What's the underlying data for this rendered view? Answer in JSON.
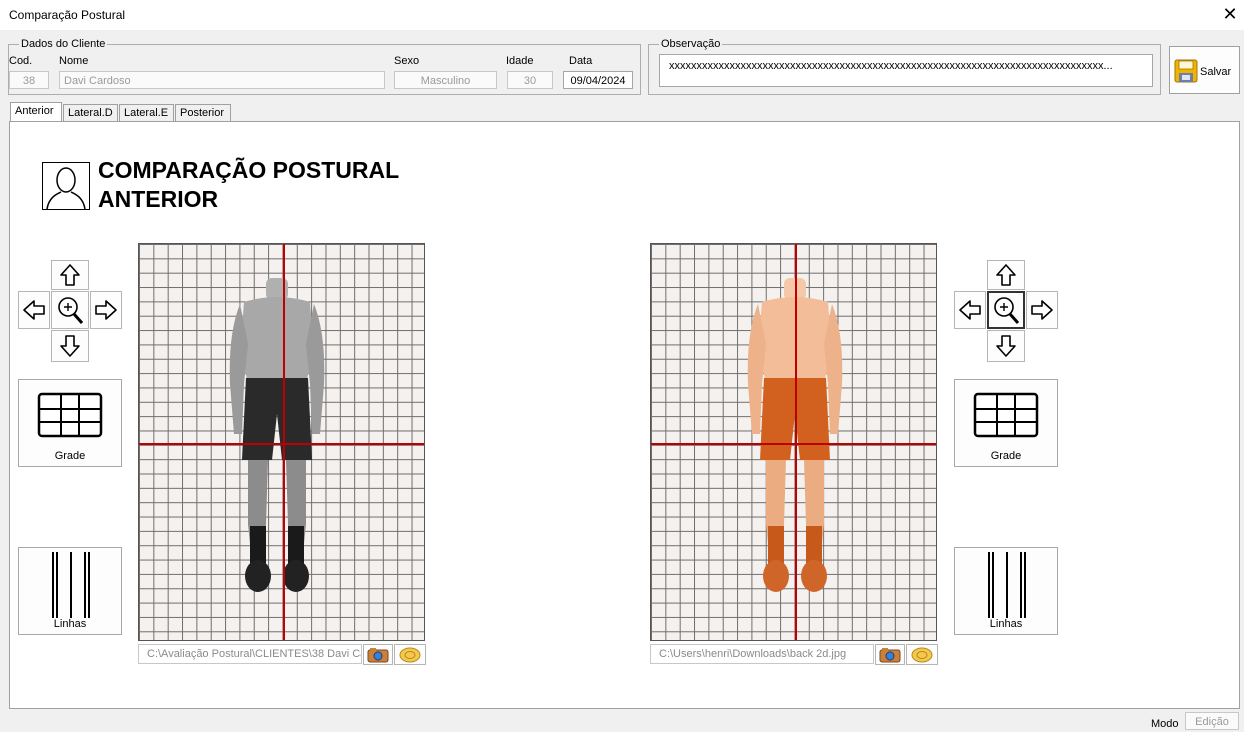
{
  "window": {
    "title": "Comparação Postural",
    "close_glyph": "✕"
  },
  "client": {
    "legend": "Dados do Cliente",
    "cod_label": "Cod.",
    "cod_value": "38",
    "nome_label": "Nome",
    "nome_value": "Davi Cardoso",
    "sexo_label": "Sexo",
    "sexo_value": "Masculino",
    "idade_label": "Idade",
    "idade_value": "30",
    "data_label": "Data",
    "data_value": "09/04/2024"
  },
  "observacao": {
    "legend": "Observação",
    "value": "xxxxxxxxxxxxxxxxxxxxxxxxxxxxxxxxxxxxxxxxxxxxxxxxxxxxxxxxxxxxxxxxxxxxxxxxxxxxxxx..."
  },
  "save_button": {
    "label": "Salvar",
    "icon": "floppy-disk-icon"
  },
  "tabs": [
    "Anterior",
    "Lateral.D",
    "Lateral.E",
    "Posterior"
  ],
  "active_tab": "Anterior",
  "heading": {
    "line1": "COMPARAÇÃO POSTURAL",
    "line2": "ANTERIOR",
    "icon": "person-head-icon"
  },
  "left_panel": {
    "image_path": "C:\\Avaliação Postural\\CLIENTES\\38 Davi Cardoso",
    "image_tint": "grayscale",
    "grade_label": "Grade",
    "linhas_label": "Linhas"
  },
  "right_panel": {
    "image_path": "C:\\Users\\henri\\Downloads\\back 2d.jpg",
    "image_tint": "orange",
    "grade_label": "Grade",
    "linhas_label": "Linhas"
  },
  "colors": {
    "guide_line": "#c00000",
    "grid_line": "#6e6e6e",
    "tint_orange": "#e06a2a"
  },
  "status": {
    "modo_label": "Modo",
    "modo_value": "Edição"
  }
}
